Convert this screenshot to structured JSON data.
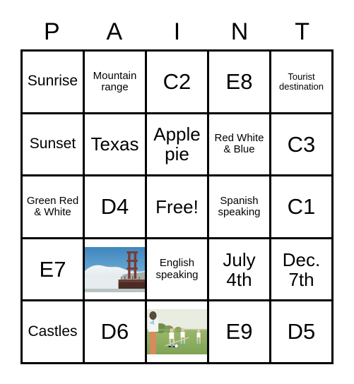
{
  "card": {
    "header_letters": [
      "P",
      "A",
      "I",
      "N",
      "T"
    ],
    "rows": [
      [
        {
          "text": "Sunrise",
          "size": "md",
          "type": "text"
        },
        {
          "text": "Mountain range",
          "size": "sm",
          "type": "text"
        },
        {
          "text": "C2",
          "size": "xl",
          "type": "text"
        },
        {
          "text": "E8",
          "size": "xl",
          "type": "text"
        },
        {
          "text": "Tourist destination",
          "size": "xs",
          "type": "text"
        }
      ],
      [
        {
          "text": "Sunset",
          "size": "md",
          "type": "text"
        },
        {
          "text": "Texas",
          "size": "lg",
          "type": "text"
        },
        {
          "text": "Apple pie",
          "size": "lg",
          "type": "text"
        },
        {
          "text": "Red White & Blue",
          "size": "sm",
          "type": "text"
        },
        {
          "text": "C3",
          "size": "xl",
          "type": "text"
        }
      ],
      [
        {
          "text": "Green Red & White",
          "size": "sm",
          "type": "text"
        },
        {
          "text": "D4",
          "size": "xl",
          "type": "text"
        },
        {
          "text": "Free!",
          "size": "lg",
          "type": "text"
        },
        {
          "text": "Spanish speaking",
          "size": "sm",
          "type": "text"
        },
        {
          "text": "C1",
          "size": "xl",
          "type": "text"
        }
      ],
      [
        {
          "text": "E7",
          "size": "xl",
          "type": "text"
        },
        {
          "text": "",
          "size": "sm",
          "type": "image",
          "image": "golden-gate-bridge-photo"
        },
        {
          "text": "English speaking",
          "size": "sm",
          "type": "text"
        },
        {
          "text": "July 4th",
          "size": "lg",
          "type": "text"
        },
        {
          "text": "Dec. 7th",
          "size": "lg",
          "type": "text"
        }
      ],
      [
        {
          "text": "Castles",
          "size": "md",
          "type": "text"
        },
        {
          "text": "D6",
          "size": "xl",
          "type": "text"
        },
        {
          "text": "",
          "size": "sm",
          "type": "image",
          "image": "youth-soccer-match-photo"
        },
        {
          "text": "E9",
          "size": "xl",
          "type": "text"
        },
        {
          "text": "D5",
          "size": "xl",
          "type": "text"
        }
      ]
    ],
    "colors": {
      "border": "#000000",
      "background": "#ffffff",
      "text": "#000000",
      "bridge_sky": "#4a90c4",
      "bridge_fog": "#eef1f3",
      "bridge_tower": "#7a3b33",
      "soccer_grass": "#88a858",
      "soccer_sky": "#e8ecdf"
    }
  }
}
